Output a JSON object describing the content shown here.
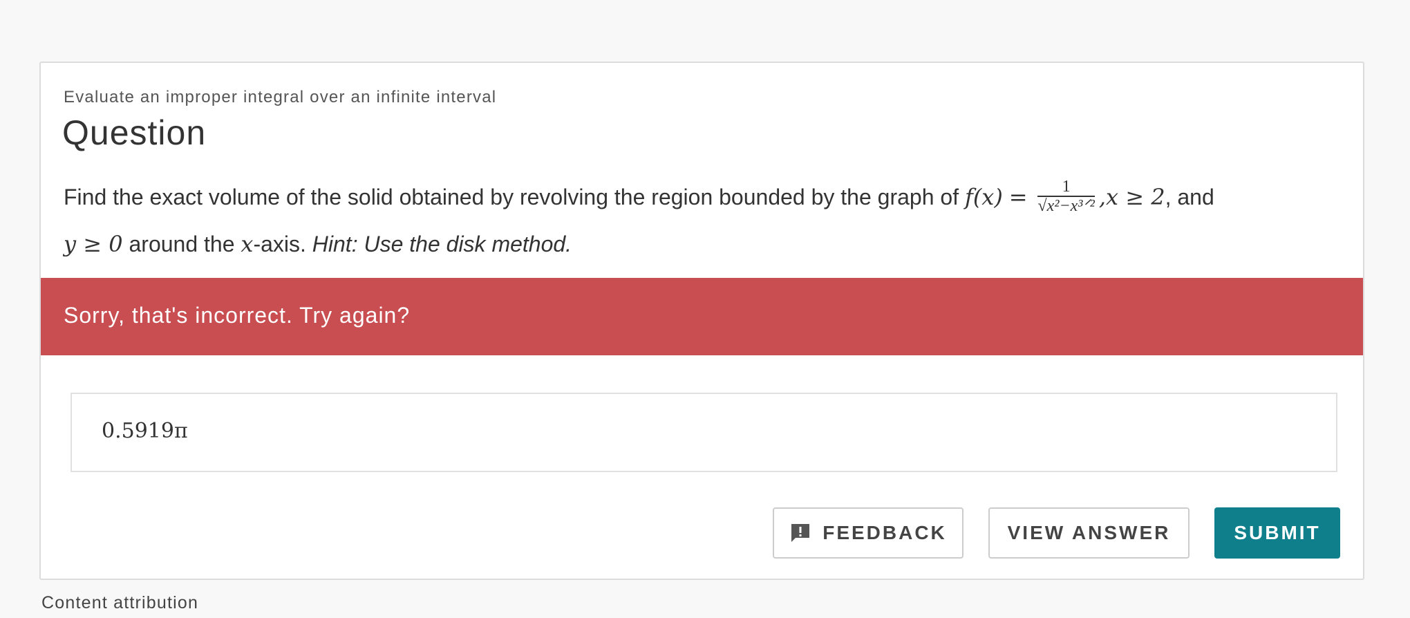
{
  "card": {
    "subtitle": "Evaluate an improper integral over an infinite interval",
    "title": "Question",
    "prompt": {
      "text_1": "Find the exact volume of the solid obtained by revolving the region bounded by the graph of",
      "fx": "f(x)",
      "eq": "=",
      "frac_num": "1",
      "frac_den": "√x²−x³ᐟ²",
      "cond_1": ",x ≥ 2",
      "text_2": ", and",
      "cond_2": "y ≥ 0",
      "text_3": "around the",
      "xvar": "x",
      "text_4": "-axis.",
      "hint": "Hint: Use the disk method."
    },
    "feedback_banner": "Sorry, that's incorrect. Try again?",
    "answer_value": "0.5919π",
    "buttons": {
      "feedback": "FEEDBACK",
      "view_answer": "VIEW ANSWER",
      "submit": "SUBMIT"
    }
  },
  "footer": {
    "attribution": "Content attribution"
  },
  "icons": {
    "feedback": "feedback-icon"
  },
  "colors": {
    "banner": "#c84e52",
    "submit": "#0f7f8c"
  }
}
